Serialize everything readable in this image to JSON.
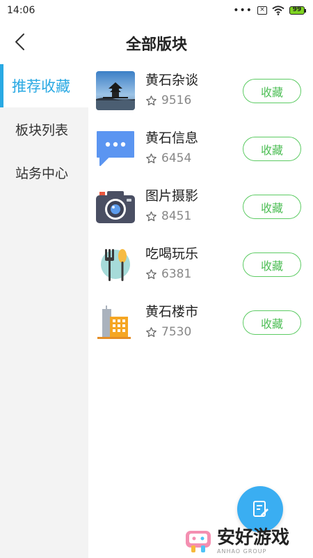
{
  "status_bar": {
    "time": "14:06",
    "battery": "99"
  },
  "header": {
    "title": "全部版块"
  },
  "sidebar": {
    "items": [
      {
        "label": "推荐收藏",
        "active": true
      },
      {
        "label": "板块列表",
        "active": false
      },
      {
        "label": "站务中心",
        "active": false
      }
    ]
  },
  "boards": [
    {
      "name": "黄石杂谈",
      "count": "9516",
      "button": "收藏",
      "icon": "pavilion-photo-icon"
    },
    {
      "name": "黄石信息",
      "count": "6454",
      "button": "收藏",
      "icon": "message-bubble-icon"
    },
    {
      "name": "图片摄影",
      "count": "8451",
      "button": "收藏",
      "icon": "camera-icon"
    },
    {
      "name": "吃喝玩乐",
      "count": "6381",
      "button": "收藏",
      "icon": "fork-spoon-icon"
    },
    {
      "name": "黄石楼市",
      "count": "7530",
      "button": "收藏",
      "icon": "buildings-icon"
    }
  ],
  "watermark": {
    "text": "安好游戏",
    "subtext": "ANHAO GROUP"
  },
  "colors": {
    "accent": "#29a9e3",
    "button_green": "#4dbe55",
    "fab_blue": "#3aaef2",
    "sidebar_bg": "#f3f3f3"
  }
}
